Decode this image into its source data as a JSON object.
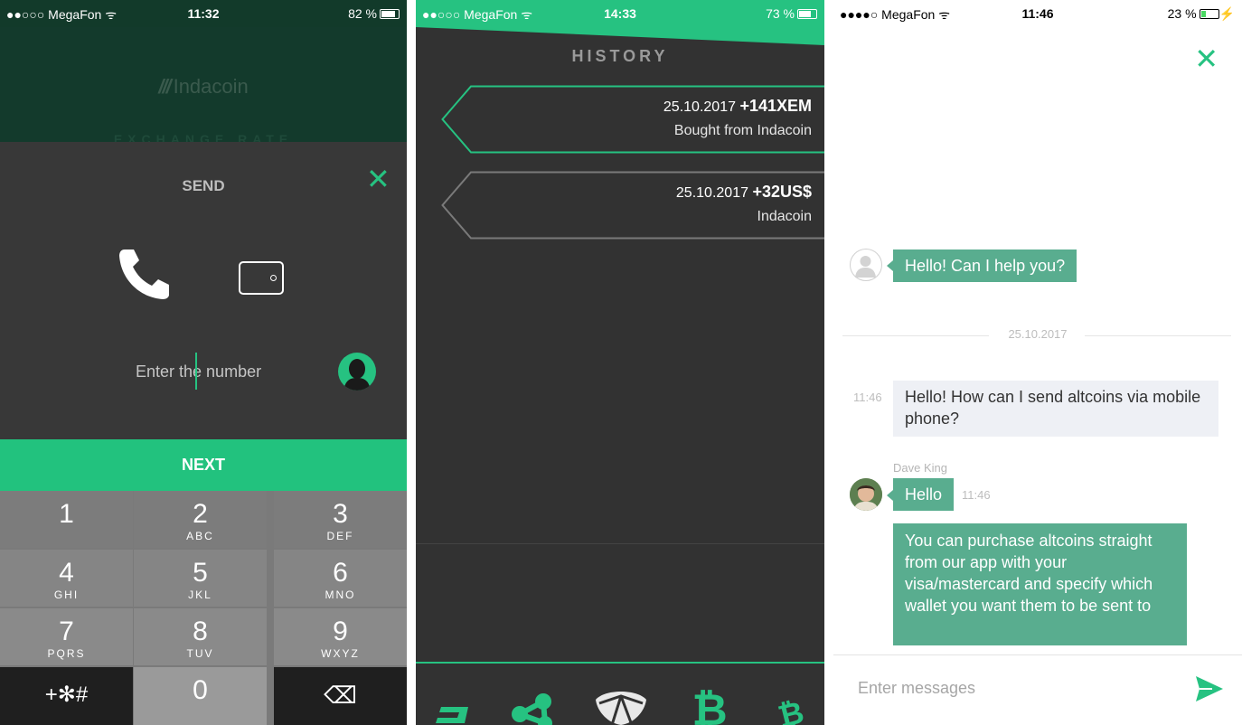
{
  "panel1": {
    "status": {
      "carrier": "●●○○○ MegaFon ᯤ",
      "time": "11:32",
      "battery": "82 %"
    },
    "brand": "Indacoin",
    "background_caption": "EXCHANGE RATE",
    "title": "SEND",
    "input_placeholder": "Enter the number",
    "next_label": "NEXT",
    "keys": [
      {
        "digit": "1",
        "letters": ""
      },
      {
        "digit": "2",
        "letters": "ABC"
      },
      {
        "digit": "3",
        "letters": "DEF"
      },
      {
        "digit": "4",
        "letters": "GHI"
      },
      {
        "digit": "5",
        "letters": "JKL"
      },
      {
        "digit": "6",
        "letters": "MNO"
      },
      {
        "digit": "7",
        "letters": "PQRS"
      },
      {
        "digit": "8",
        "letters": "TUV"
      },
      {
        "digit": "9",
        "letters": "WXYZ"
      },
      {
        "digit": "+✻#",
        "letters": ""
      },
      {
        "digit": "0",
        "letters": ""
      },
      {
        "digit": "⌫",
        "letters": ""
      }
    ],
    "colors": {
      "accent": "#22c27e",
      "sheet": "#383838"
    }
  },
  "panel2": {
    "status": {
      "carrier": "●●○○○ MegaFon ᯤ",
      "time": "14:33",
      "battery": "73 %"
    },
    "title": "HISTORY",
    "items": [
      {
        "date": "25.10.2017",
        "amount": "+141XEM",
        "desc": "Bought from Indacoin"
      },
      {
        "date": "25.10.2017",
        "amount": "+32US$",
        "desc": "Indacoin"
      }
    ],
    "wallet_icons": [
      "dash-icon",
      "ripple-icon",
      "nem-icon",
      "bitcoin-icon",
      "bitcoin-cash-icon"
    ]
  },
  "panel3": {
    "status": {
      "carrier": "●●●●○ MegaFon ᯤ",
      "time": "11:46",
      "battery": "23 %"
    },
    "messages": {
      "support_greeting": "Hello! Can I help you?",
      "date_divider": "25.10.2017",
      "user_question": "Hello! How can I send altcoins via mobile phone?",
      "user_time": "11:46",
      "agent_name": "Dave King",
      "agent_hello": "Hello",
      "agent_hello_time": "11:46",
      "agent_answer": "You can purchase altcoins straight from our app with your visa/mastercard and specify which wallet you want them to be sent to"
    },
    "input_placeholder": "Enter messages",
    "colors": {
      "accent": "#26c281",
      "bubble": "#59ad8f"
    }
  }
}
